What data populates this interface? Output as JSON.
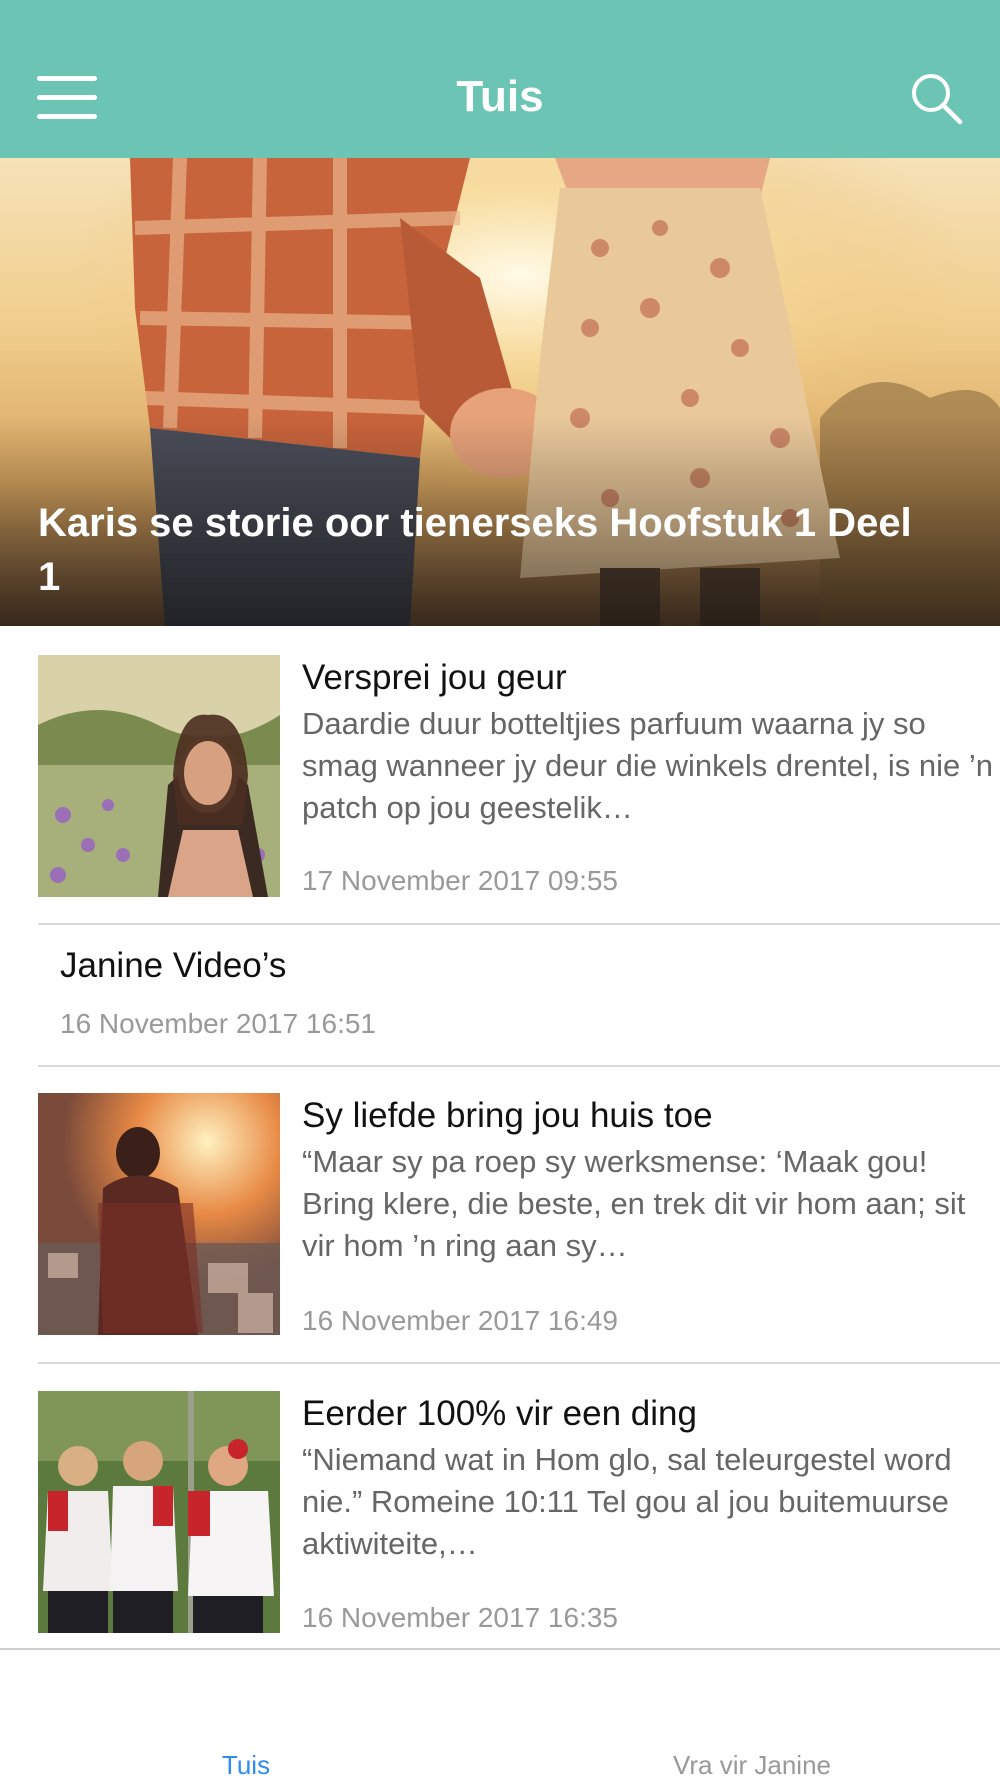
{
  "header": {
    "title": "Tuis",
    "menu_icon": "hamburger-menu-icon",
    "search_icon": "search-icon",
    "background": "#6cc4b4"
  },
  "hero": {
    "title": "Karis se storie oor tienerseks Hoofstuk 1 Deel 1"
  },
  "articles": [
    {
      "title": "Versprei jou geur",
      "excerpt": "Daardie duur botteltjies parfuum waarna jy so smag wanneer jy deur die winkels drentel, is nie ’n patch op jou geestelik…",
      "date": "17 November 2017 09:55"
    },
    {
      "title": "Sy liefde bring jou huis toe",
      "excerpt": "“Maar sy pa roep sy werksmense: ‘Maak gou! Bring klere, die beste, en trek dit vir hom aan; sit vir hom ’n ring aan sy…",
      "date": "16 November 2017 16:49"
    },
    {
      "title": "Eerder 100% vir een ding",
      "excerpt": "“Niemand wat in Hom glo, sal teleurgestel word nie.” Romeine 10:11 Tel gou al jou buitemuurse aktiwiteite,…",
      "date": "16 November 2017 16:35"
    }
  ],
  "video_item": {
    "title": "Janine Video’s",
    "date": "16 November 2017 16:51"
  },
  "tabbar": {
    "tabs": [
      {
        "label": "Tuis",
        "active": true,
        "color": "#2d8ef0"
      },
      {
        "label": "Vra vir Janine",
        "active": false,
        "color": "#999999"
      }
    ]
  }
}
